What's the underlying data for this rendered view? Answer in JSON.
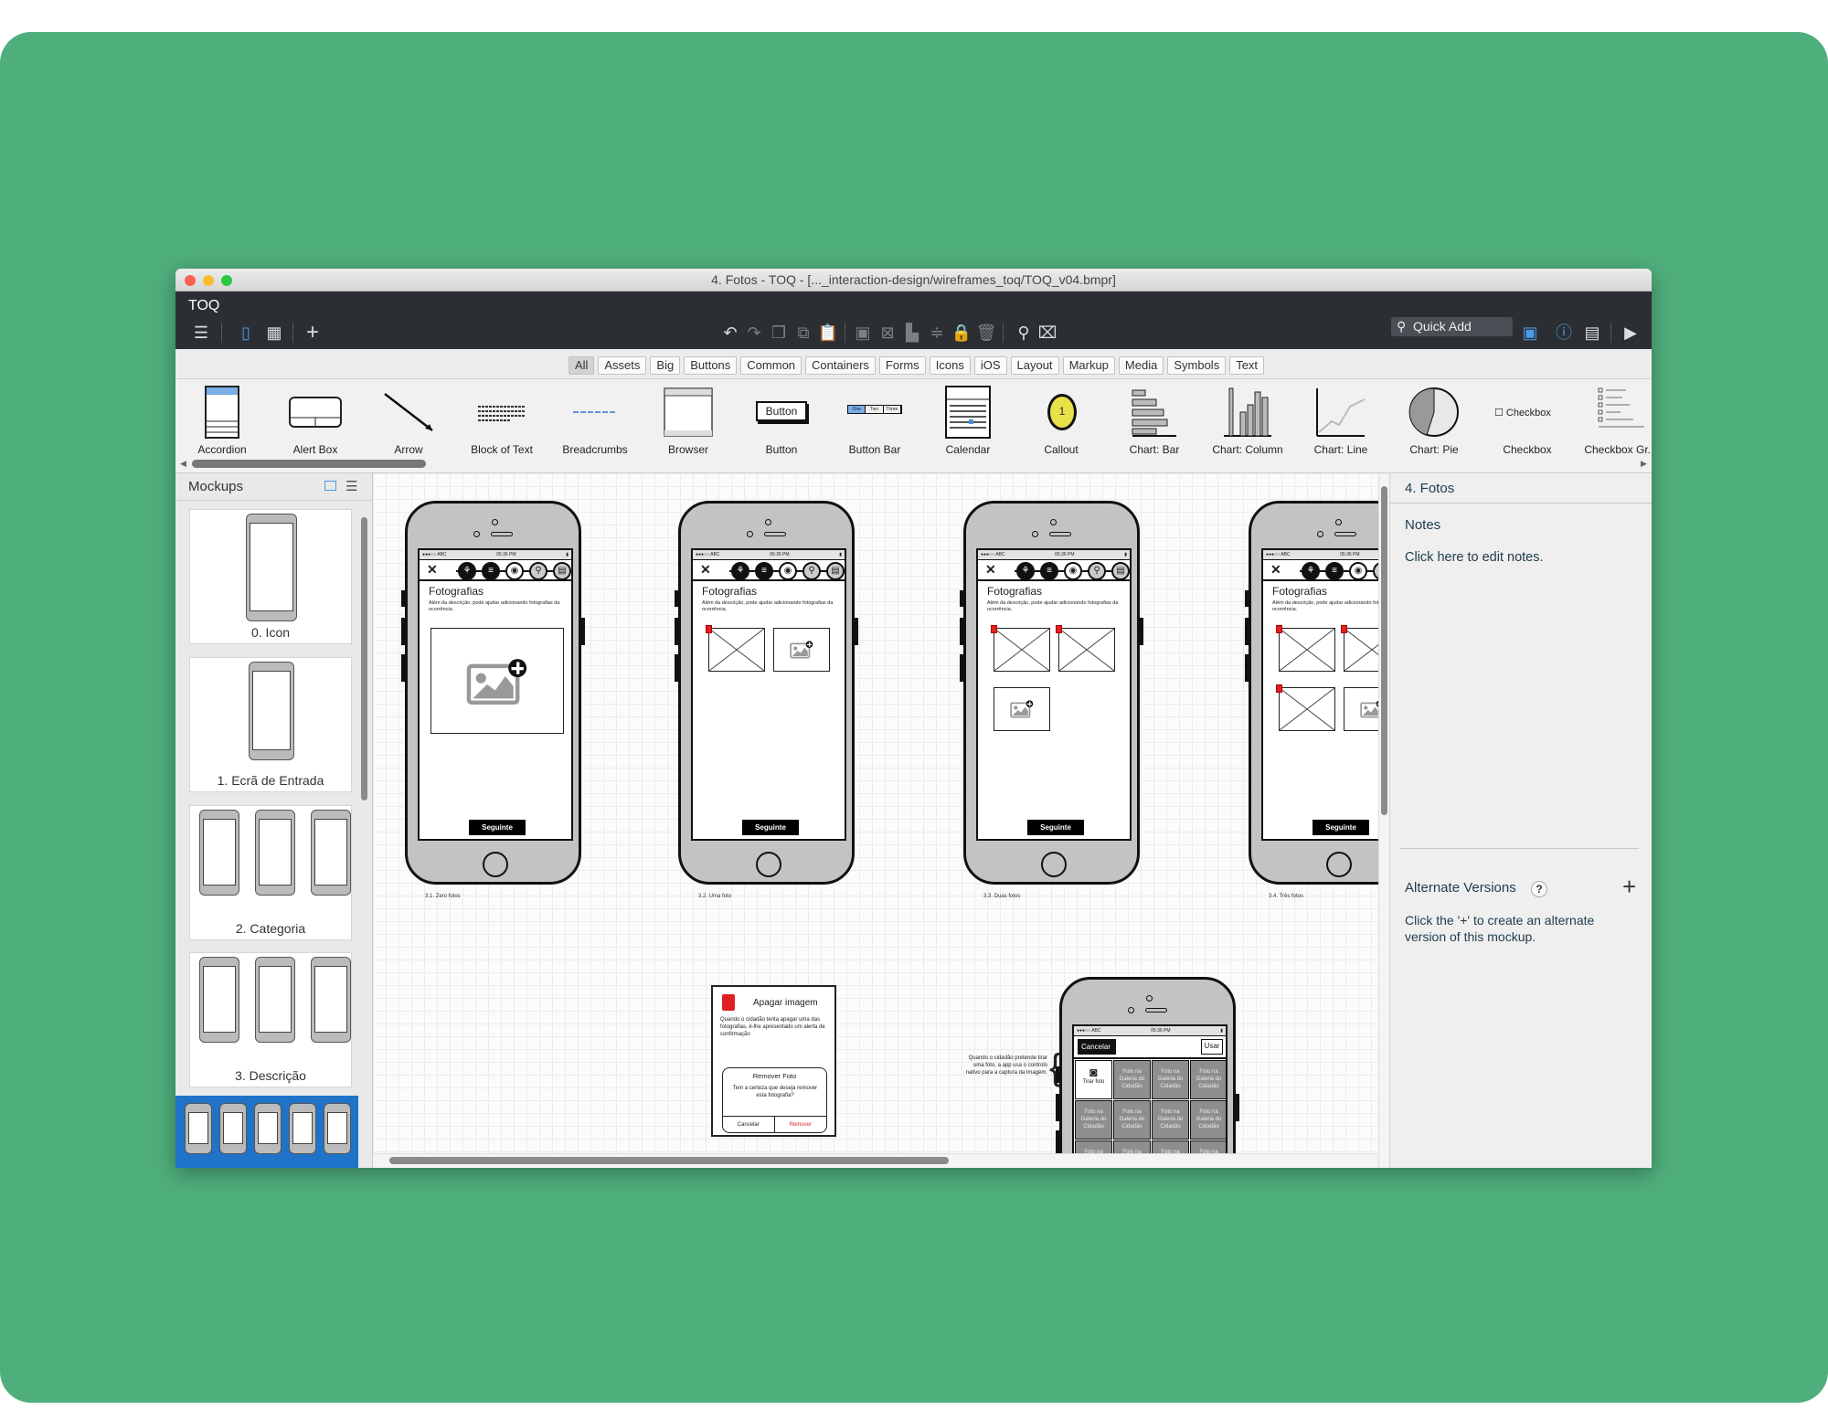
{
  "window": {
    "title": "4. Fotos - TOQ - [..._interaction-design/wireframes_toq/TOQ_v04.bmpr]",
    "app_name": "TOQ"
  },
  "toolbar": {
    "quick_add": "Quick Add"
  },
  "filters": [
    "All",
    "Assets",
    "Big",
    "Buttons",
    "Common",
    "Containers",
    "Forms",
    "Icons",
    "iOS",
    "Layout",
    "Markup",
    "Media",
    "Symbols",
    "Text"
  ],
  "filter_selected": "All",
  "library": [
    "Accordion",
    "Alert Box",
    "Arrow",
    "Block of Text",
    "Breadcrumbs",
    "Browser",
    "Button",
    "Button Bar",
    "Calendar",
    "Callout",
    "Chart: Bar",
    "Chart: Column",
    "Chart: Line",
    "Chart: Pie",
    "Checkbox",
    "Checkbox Gr..."
  ],
  "library_previews": {
    "button": "Button",
    "button_bar": [
      "One",
      "Two",
      "Three"
    ],
    "checkbox": "Checkbox",
    "callout": "1"
  },
  "sidebar": {
    "title": "Mockups",
    "items": [
      {
        "label": "0. Icon",
        "thumbs": 1
      },
      {
        "label": "1. Ecrã de Entrada",
        "thumbs": 1
      },
      {
        "label": "2. Categoria",
        "thumbs": 3
      },
      {
        "label": "3. Descrição",
        "thumbs": 3
      },
      {
        "label": "4. Fotos",
        "thumbs": 5,
        "selected": true
      }
    ]
  },
  "canvas": {
    "phones": [
      {
        "label": "3.1. Zero fotos",
        "slots": [
          "big-add"
        ]
      },
      {
        "label": "3.2. Uma foto",
        "slots": [
          "photo",
          "add"
        ]
      },
      {
        "label": "3.3. Duas fotos",
        "slots": [
          "photo",
          "photo",
          "add"
        ]
      },
      {
        "label": "3.4. Três fotos",
        "slots": [
          "photo",
          "photo",
          "photo",
          "add"
        ]
      }
    ],
    "screen": {
      "carrier": "●●●○○ ABC",
      "time": "05:36 PM",
      "close": "✕",
      "title": "Fotografias",
      "description": "Além da descrição, pode ajudar adicionando fotografias da ocorrência.",
      "next_button": "Seguinte"
    },
    "alert_note": {
      "title": "Apagar imagem",
      "text": "Quando o cidadão tenta apagar uma das fotografias, é-lhe apresentado um alerta de confirmação",
      "dialog_title": "Remover Foto",
      "dialog_text": "Tem a certeza que deseja remover esta fotografia?",
      "cancel": "Cancelar",
      "remove": "Remover"
    },
    "camera": {
      "annotation": "Quando o cidadão pretende tirar uma foto, a app usa o controlo nativo para a captura da imagem.",
      "cancel": "Cancelar",
      "use": "Usar",
      "take_photo": "Tirar foto",
      "gallery_tile": "Foto na Galeria do Cidadão"
    }
  },
  "right_panel": {
    "mockup_title": "4. Fotos",
    "notes_label": "Notes",
    "notes_placeholder": "Click here to edit notes.",
    "alt_versions_label": "Alternate Versions",
    "alt_versions_help": "?",
    "alt_versions_add": "+",
    "alt_versions_text": "Click the '+' to create an alternate version of this mockup."
  },
  "colors": {
    "background": "#4faf7c",
    "toolbar": "#2b2f33",
    "selection": "#1f73c8",
    "alert_red": "#e02020"
  }
}
